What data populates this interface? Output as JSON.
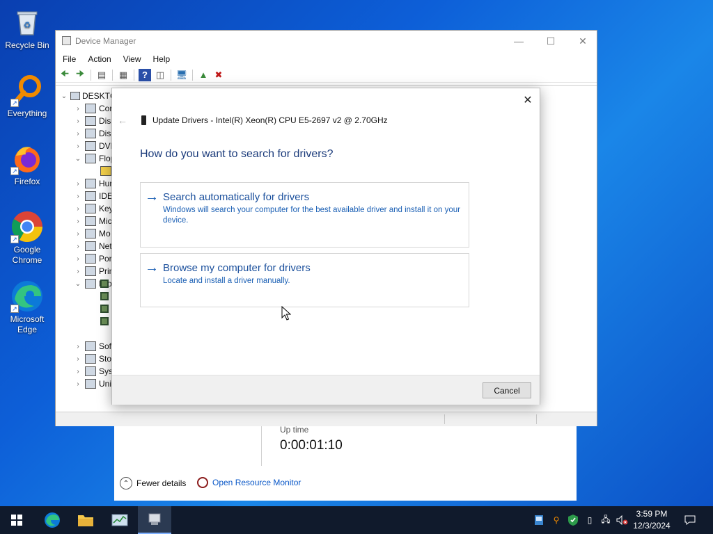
{
  "desktop": {
    "icons": [
      {
        "label": "Recycle Bin"
      },
      {
        "label": "Everything"
      },
      {
        "label": "Firefox"
      },
      {
        "label": "Google Chrome"
      },
      {
        "label": "Microsoft Edge"
      }
    ]
  },
  "task_manager": {
    "uptime_label": "Up time",
    "uptime_value": "0:00:01:10",
    "fewer_details": "Fewer details",
    "open_resource_monitor": "Open Resource Monitor"
  },
  "device_manager": {
    "title": "Device Manager",
    "menu": [
      "File",
      "Action",
      "View",
      "Help"
    ],
    "tree": {
      "root": "DESKTC",
      "items": [
        {
          "label": "Cor",
          "expanded": false
        },
        {
          "label": "Disl",
          "expanded": false
        },
        {
          "label": "Disp",
          "expanded": false
        },
        {
          "label": "DVD",
          "expanded": false
        },
        {
          "label": "Flop",
          "expanded": true
        },
        {
          "label": "Hur",
          "expanded": false
        },
        {
          "label": "IDE",
          "expanded": false
        },
        {
          "label": "Key",
          "expanded": false
        },
        {
          "label": "Mic",
          "expanded": false
        },
        {
          "label": "Mo",
          "expanded": false
        },
        {
          "label": "Net",
          "expanded": false
        },
        {
          "label": "Por",
          "expanded": false
        },
        {
          "label": "Prin",
          "expanded": false
        },
        {
          "label": "Pro",
          "expanded": true
        },
        {
          "label": "Sof",
          "expanded": false
        },
        {
          "label": "Sto",
          "expanded": false
        },
        {
          "label": "Syst",
          "expanded": false
        },
        {
          "label": "Uni",
          "expanded": false
        }
      ]
    }
  },
  "update_dialog": {
    "title": "Update Drivers - Intel(R) Xeon(R) CPU E5-2697 v2 @ 2.70GHz",
    "heading": "How do you want to search for drivers?",
    "options": [
      {
        "title": "Search automatically for drivers",
        "description": "Windows will search your computer for the best available driver and install it on your device."
      },
      {
        "title": "Browse my computer for drivers",
        "description": "Locate and install a driver manually."
      }
    ],
    "cancel_label": "Cancel"
  },
  "taskbar": {
    "clock_time": "3:59 PM",
    "clock_date": "12/3/2024"
  },
  "colors": {
    "link_blue": "#1a4f9c",
    "desktop_blue": "#0d5fd8",
    "taskbar": "#101a2c"
  }
}
